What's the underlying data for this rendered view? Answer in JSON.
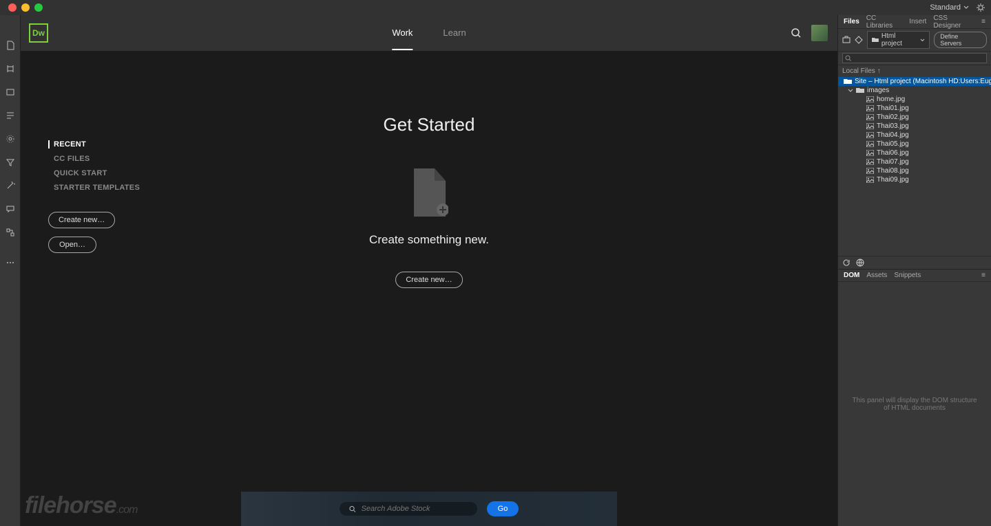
{
  "titlebar": {
    "workspace": "Standard"
  },
  "logo": "Dw",
  "tabs": {
    "work": "Work",
    "learn": "Learn"
  },
  "side_items": [
    {
      "label": "RECENT",
      "active": true
    },
    {
      "label": "CC FILES",
      "active": false
    },
    {
      "label": "QUICK START",
      "active": false
    },
    {
      "label": "STARTER TEMPLATES",
      "active": false
    }
  ],
  "buttons": {
    "create": "Create new…",
    "open": "Open…"
  },
  "get_started": {
    "title": "Get Started",
    "subtitle": "Create something new.",
    "create": "Create new…"
  },
  "stock": {
    "placeholder": "Search Adobe Stock",
    "go": "Go"
  },
  "watermark": {
    "main": "filehorse",
    "suffix": ".com"
  },
  "panels": {
    "files_tabs": [
      "Files",
      "CC Libraries",
      "Insert",
      "CSS Designer"
    ],
    "site_dropdown": "Html project",
    "define": "Define Servers",
    "local_files": "Local Files ↑",
    "tree": {
      "site": "Site – Html project (Macintosh HD:Users:Eug…",
      "folder": "images",
      "files": [
        "home.jpg",
        "Thai01.jpg",
        "Thai02.jpg",
        "Thai03.jpg",
        "Thai04.jpg",
        "Thai05.jpg",
        "Thai06.jpg",
        "Thai07.jpg",
        "Thai08.jpg",
        "Thai09.jpg"
      ]
    },
    "dom_tabs": [
      "DOM",
      "Assets",
      "Snippets"
    ],
    "dom_empty": "This panel will display the DOM structure of HTML documents"
  }
}
